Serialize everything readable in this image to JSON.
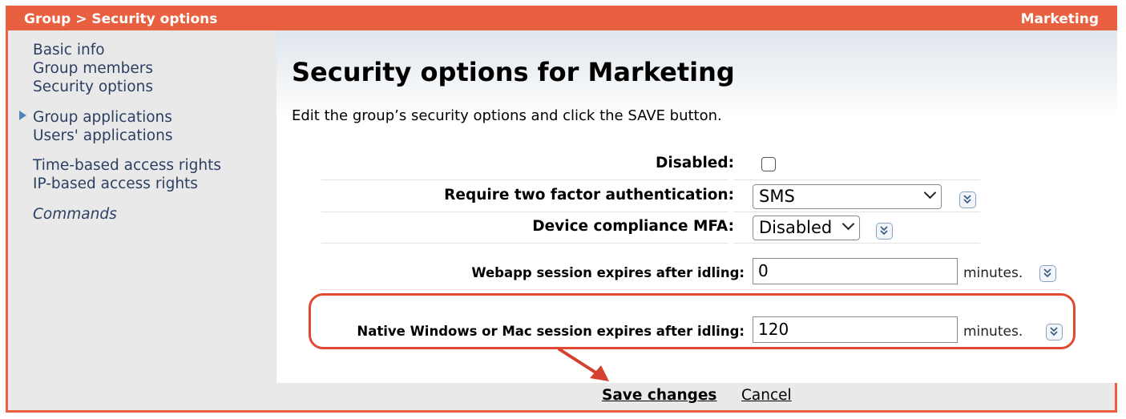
{
  "header": {
    "breadcrumb": "Group > Security options",
    "group_name": "Marketing"
  },
  "sidebar": {
    "items": [
      {
        "label": "Basic info",
        "active": false
      },
      {
        "label": "Group members",
        "active": false
      },
      {
        "label": "Security options",
        "active": true
      },
      {
        "label": "Group applications",
        "active": false
      },
      {
        "label": "Users' applications",
        "active": false
      },
      {
        "label": "Time-based access rights",
        "active": false
      },
      {
        "label": "IP-based access rights",
        "active": false
      },
      {
        "label": "Commands",
        "active": false
      }
    ]
  },
  "main": {
    "title": "Security options for Marketing",
    "description": "Edit the group’s security options and click the SAVE button.",
    "fields": {
      "disabled": {
        "label": "Disabled:",
        "checked": false
      },
      "two_factor": {
        "label": "Require two factor authentication:",
        "value": "SMS"
      },
      "device_mfa": {
        "label": "Device compliance MFA:",
        "value": "Disabled"
      },
      "webapp_idle": {
        "label": "Webapp session expires after idling:",
        "value": "0",
        "unit": "minutes."
      },
      "native_idle": {
        "label": "Native Windows or Mac session expires after idling:",
        "value": "120",
        "unit": "minutes."
      }
    }
  },
  "footer": {
    "save_label": "Save changes",
    "cancel_label": "Cancel"
  },
  "colors": {
    "accent": "#e8603f",
    "highlight": "#e04a34",
    "nav_text": "#2b3f62",
    "panel_bg": "#e9e9ea"
  },
  "icons": [
    "nav-active-arrow-icon",
    "expand-icon",
    "chevron-down-icon",
    "annotation-arrow-icon"
  ]
}
